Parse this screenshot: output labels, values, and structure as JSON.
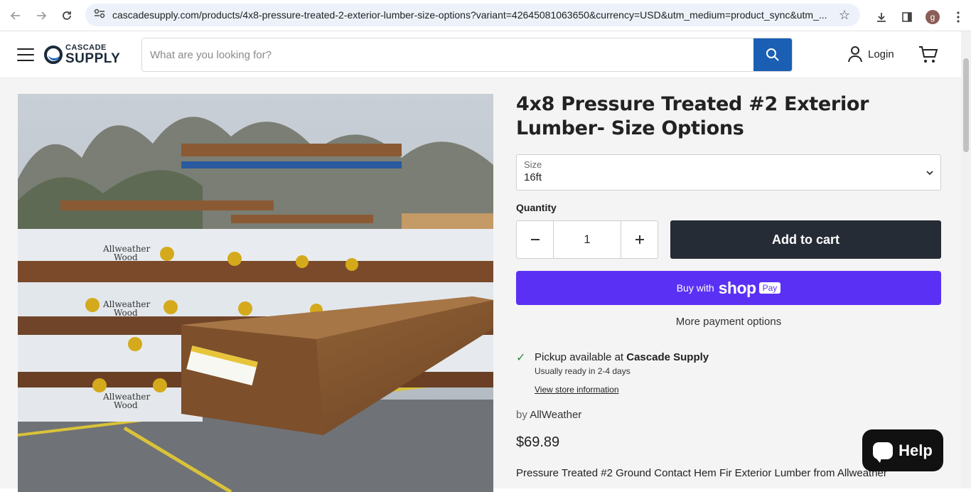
{
  "browser": {
    "url": "cascadesupply.com/products/4x8-pressure-treated-2-exterior-lumber-size-options?variant=42645081063650&currency=USD&utm_medium=product_sync&utm_...",
    "profile_initial": "g"
  },
  "header": {
    "logo_top": "CASCADE",
    "logo_bottom": "SUPPLY",
    "search_placeholder": "What are you looking for?",
    "login_label": "Login"
  },
  "product": {
    "title": "4x8 Pressure Treated #2 Exterior Lumber- Size Options",
    "size_label": "Size",
    "size_value": "16ft",
    "quantity_label": "Quantity",
    "quantity_value": "1",
    "add_to_cart_label": "Add to cart",
    "shop_pay_buy": "Buy with",
    "shop_pay_shop": "shop",
    "shop_pay_pay": "Pay",
    "more_payment": "More payment options",
    "pickup_text": "Pickup available at",
    "pickup_store": "Cascade Supply",
    "pickup_ready": "Usually ready in 2-4 days",
    "store_info_link": "View store information",
    "vendor_prefix": "by",
    "vendor": "AllWeather",
    "price": "$69.89",
    "description": "Pressure Treated #2 Ground Contact Hem Fir Exterior Lumber from Allweather",
    "image_labels": [
      "Allweather Wood"
    ]
  },
  "chat": {
    "help_label": "Help"
  },
  "colors": {
    "search_button": "#1a5fb4",
    "add_to_cart": "#262c36",
    "shop_pay": "#5a31f4",
    "pickup_check": "#2e8b3a"
  }
}
